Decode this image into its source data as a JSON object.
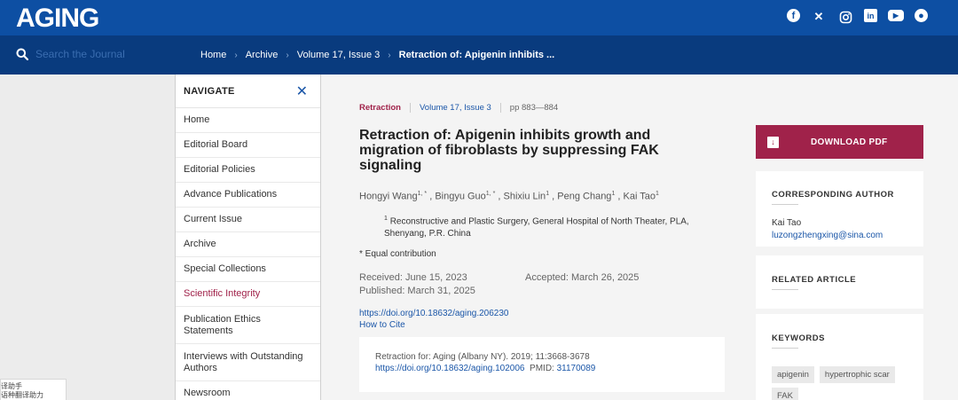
{
  "header": {
    "logo_text": "AGING",
    "social_icons": [
      "facebook-icon",
      "x-icon",
      "instagram-icon",
      "linkedin-icon",
      "youtube-icon",
      "reddit-icon"
    ]
  },
  "navbar": {
    "search_placeholder": "Search the Journal",
    "breadcrumbs": [
      "Home",
      "Archive",
      "Volume 17, Issue 3",
      "Retraction of: Apigenin inhibits ..."
    ]
  },
  "sidebar": {
    "title": "NAVIGATE",
    "items": [
      {
        "label": "Home"
      },
      {
        "label": "Editorial Board"
      },
      {
        "label": "Editorial Policies"
      },
      {
        "label": "Advance Publications"
      },
      {
        "label": "Current Issue"
      },
      {
        "label": "Archive"
      },
      {
        "label": "Special Collections"
      },
      {
        "label": "Scientific Integrity"
      },
      {
        "label": "Publication Ethics Statements"
      },
      {
        "label": "Interviews with Outstanding Authors"
      },
      {
        "label": "Newsroom"
      }
    ]
  },
  "tooltip": {
    "line1": "译助手",
    "line2": "语种翻译助力"
  },
  "article": {
    "type": "Retraction",
    "volume": "Volume 17, Issue 3",
    "pages": "pp 883—884",
    "title": "Retraction of: Apigenin inhibits growth and migration of fibroblasts by suppressing FAK signaling",
    "authors": [
      {
        "name": "Hongyi Wang",
        "sup": "1, *"
      },
      {
        "name": "Bingyu Guo",
        "sup": "1, *"
      },
      {
        "name": "Shixiu Lin",
        "sup": "1"
      },
      {
        "name": "Peng Chang",
        "sup": "1"
      },
      {
        "name": "Kai Tao",
        "sup": "1"
      }
    ],
    "affiliation_sup": "1",
    "affiliation": "Reconstructive and Plastic Surgery, General Hospital of North Theater, PLA, Shenyang, P.R. China",
    "equal_contribution": "* Equal contribution",
    "received": "Received: June 15, 2023",
    "accepted": "Accepted: March 26, 2025",
    "published": "Published: March 31, 2025",
    "doi": "https://doi.org/10.18632/aging.206230",
    "how_to_cite": "How to Cite",
    "retraction_for": "Retraction for: Aging (Albany NY). 2019; 11:3668-3678",
    "retraction_doi": "https://doi.org/10.18632/aging.102006",
    "pmid_label": "PMID:",
    "pmid": "31170089"
  },
  "right": {
    "download_label": "DOWNLOAD PDF",
    "corresponding_title": "CORRESPONDING AUTHOR",
    "corresponding_name": "Kai Tao",
    "corresponding_email": "luzongzhengxing@sina.com",
    "related_title": "RELATED ARTICLE",
    "keywords_title": "KEYWORDS",
    "keywords": [
      "apigenin",
      "hypertrophic scar",
      "FAK"
    ]
  },
  "colors": {
    "header_blue": "#0d4fa3",
    "nav_blue": "#093b7e",
    "accent_crimson": "#a0224a",
    "link_blue": "#1a56a8"
  }
}
